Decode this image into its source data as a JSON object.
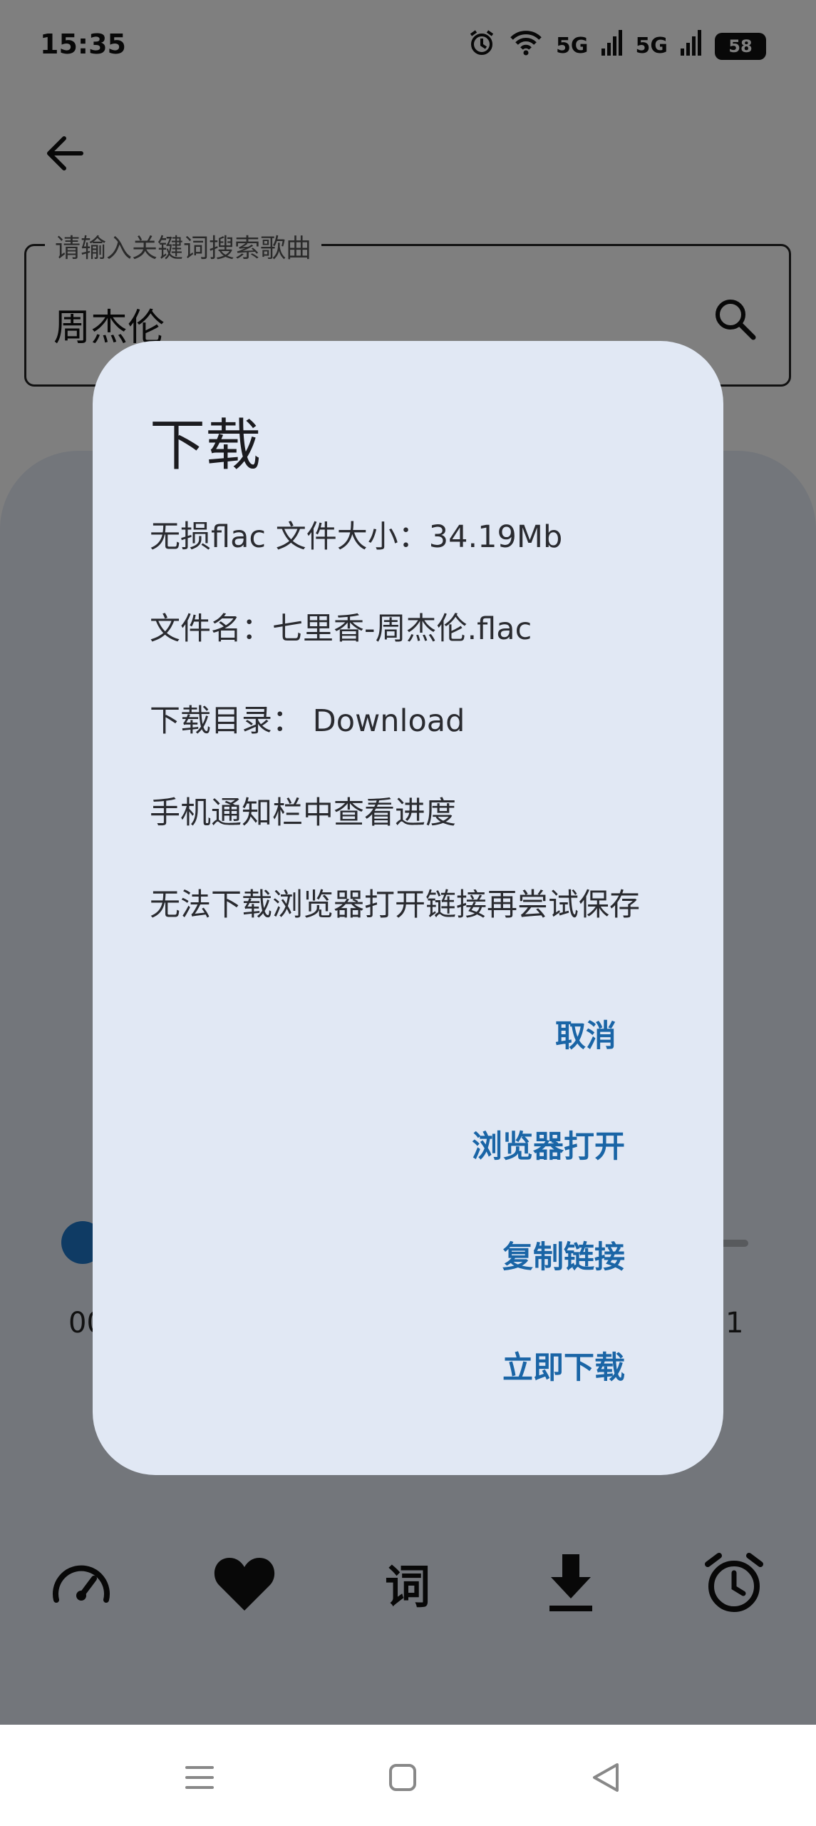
{
  "status_bar": {
    "time": "15:35",
    "signal_1": "5G",
    "signal_2": "5G",
    "battery": "58"
  },
  "search": {
    "label": "请输入关键词搜索歌曲",
    "value": "周杰伦"
  },
  "player": {
    "time_elapsed": "00",
    "time_total": "1"
  },
  "controls": {
    "lyrics_label": "词"
  },
  "dialog": {
    "title": "下载",
    "lines": [
      "无损flac 文件大小：34.19Mb",
      "文件名：七里香-周杰伦.flac",
      "下载目录： Download",
      "手机通知栏中查看进度",
      "无法下载浏览器打开链接再尝试保存"
    ],
    "buttons": {
      "cancel": "取消",
      "open_browser": "浏览器打开",
      "copy_link": "复制链接",
      "download_now": "立即下载"
    }
  },
  "colors": {
    "dialog_bg": "#e1e8f4",
    "accent": "#1a65a6",
    "progress": "#1f77c9"
  }
}
